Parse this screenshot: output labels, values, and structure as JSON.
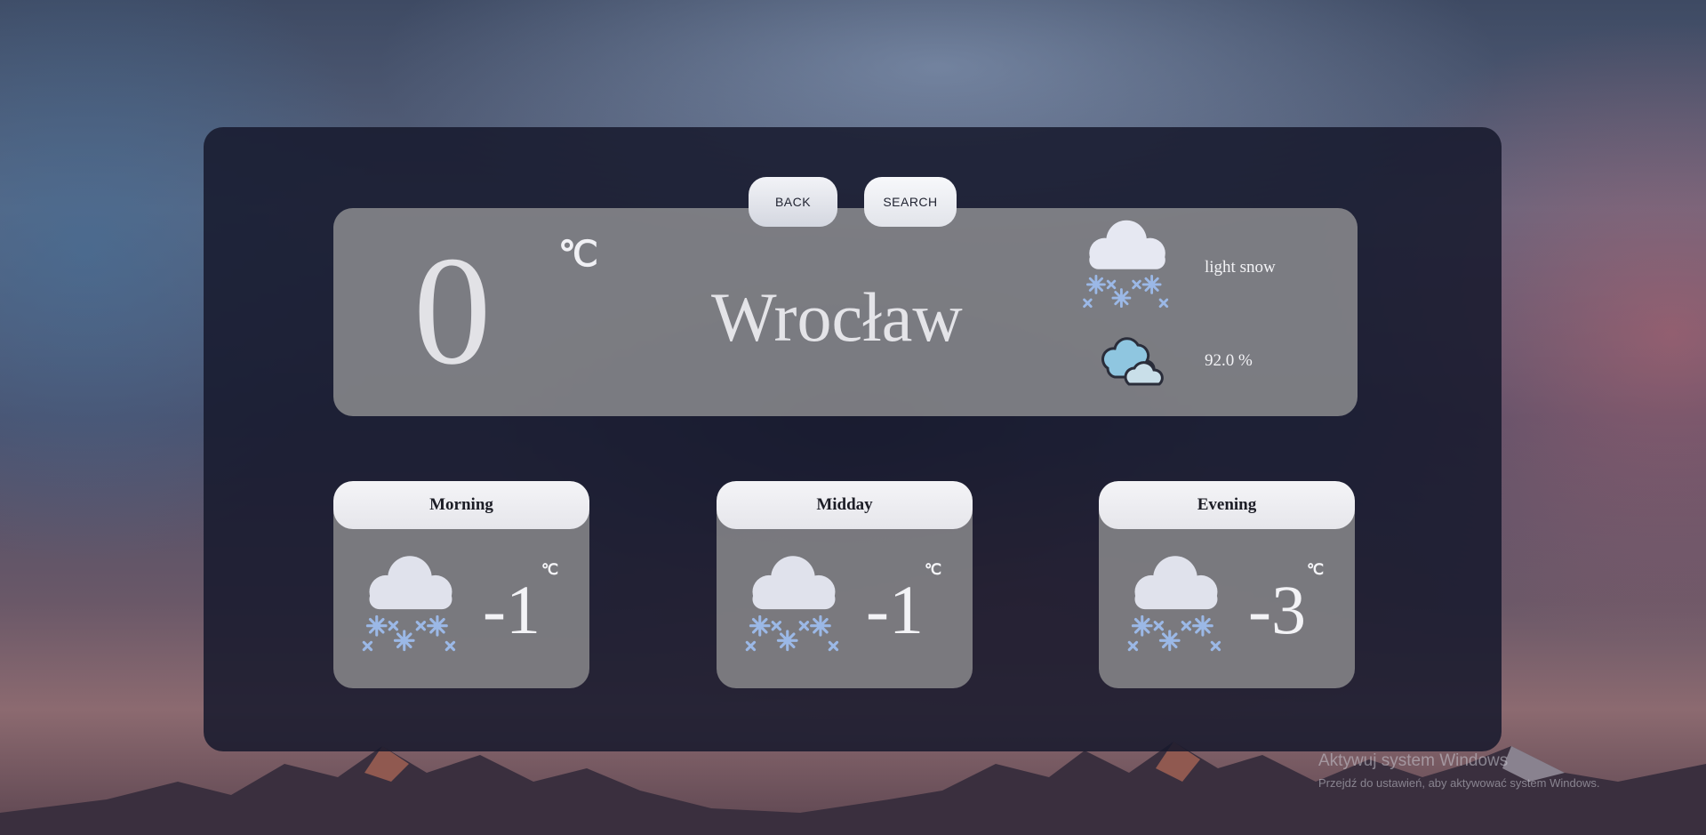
{
  "buttons": {
    "back": "BACK",
    "search": "SEARCH"
  },
  "current": {
    "temperature": "0",
    "unit": "℃",
    "city": "Wrocław",
    "description": "light snow",
    "description_icon": "snow-cloud-icon",
    "humidity": "92.0 %",
    "humidity_icon": "clouds-icon"
  },
  "forecast": [
    {
      "label": "Morning",
      "temperature": "-1",
      "unit": "℃",
      "icon": "snow-cloud-icon"
    },
    {
      "label": "Midday",
      "temperature": "-1",
      "unit": "℃",
      "icon": "snow-cloud-icon"
    },
    {
      "label": "Evening",
      "temperature": "-3",
      "unit": "℃",
      "icon": "snow-cloud-icon"
    }
  ],
  "watermark": {
    "line1": "Aktywuj system Windows",
    "line2": "Przejdź do ustawień, aby aktywować system Windows."
  },
  "colors": {
    "panel": "#16182c",
    "card": "#9b9b9b",
    "snowflake": "#9bb8e6",
    "cloud": "#e6e8f2"
  }
}
